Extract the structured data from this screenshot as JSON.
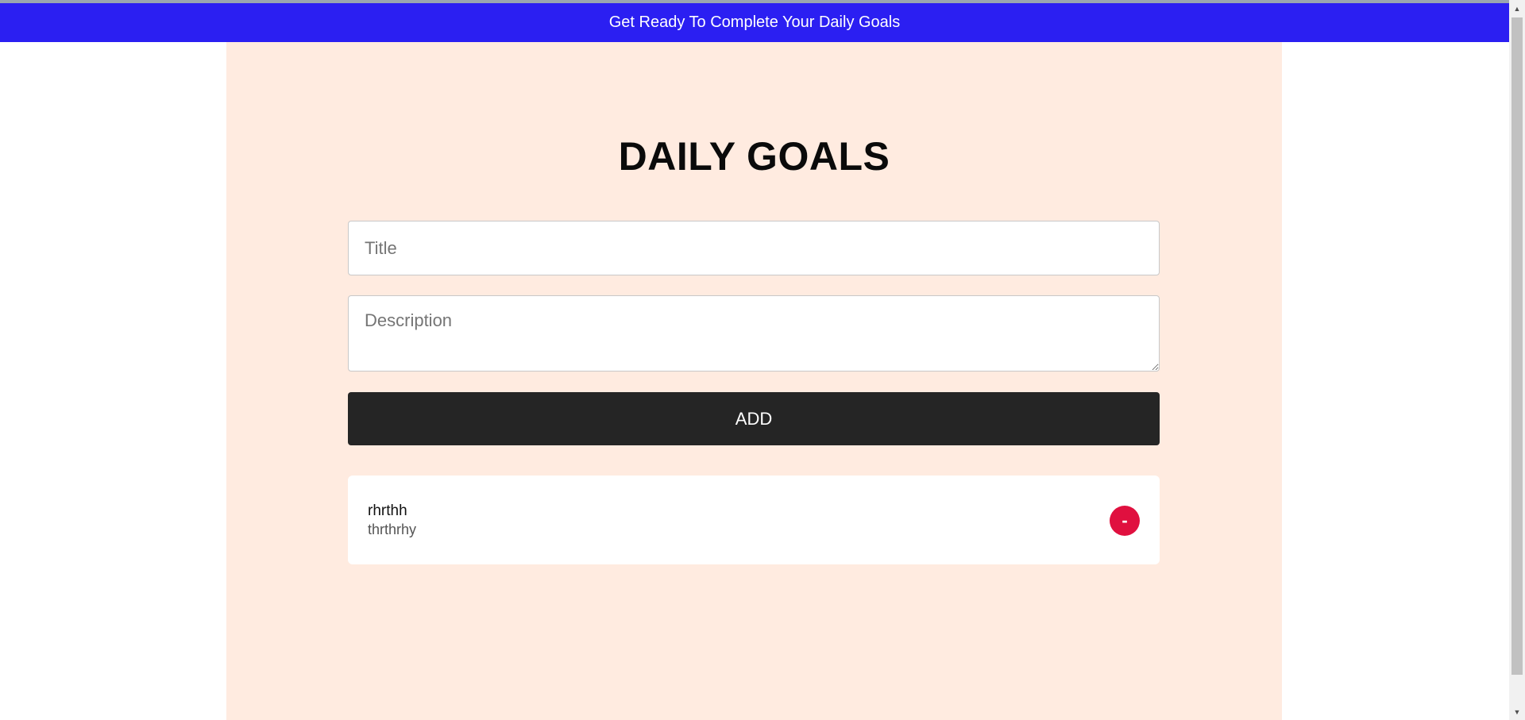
{
  "banner": {
    "text": "Get Ready To Complete Your Daily Goals"
  },
  "header": {
    "title": "DAILY GOALS"
  },
  "form": {
    "title_placeholder": "Title",
    "title_value": "",
    "description_placeholder": "Description",
    "description_value": "",
    "add_label": "ADD"
  },
  "goals": [
    {
      "title": "rhrthh",
      "description": "thrthrhy",
      "remove_label": "-"
    }
  ],
  "scrollbar": {
    "up_icon": "▲",
    "down_icon": "▼"
  },
  "colors": {
    "banner": "#2b1ff2",
    "panel": "#ffebe0",
    "add_button": "#252525",
    "remove_button": "#e0103f"
  }
}
